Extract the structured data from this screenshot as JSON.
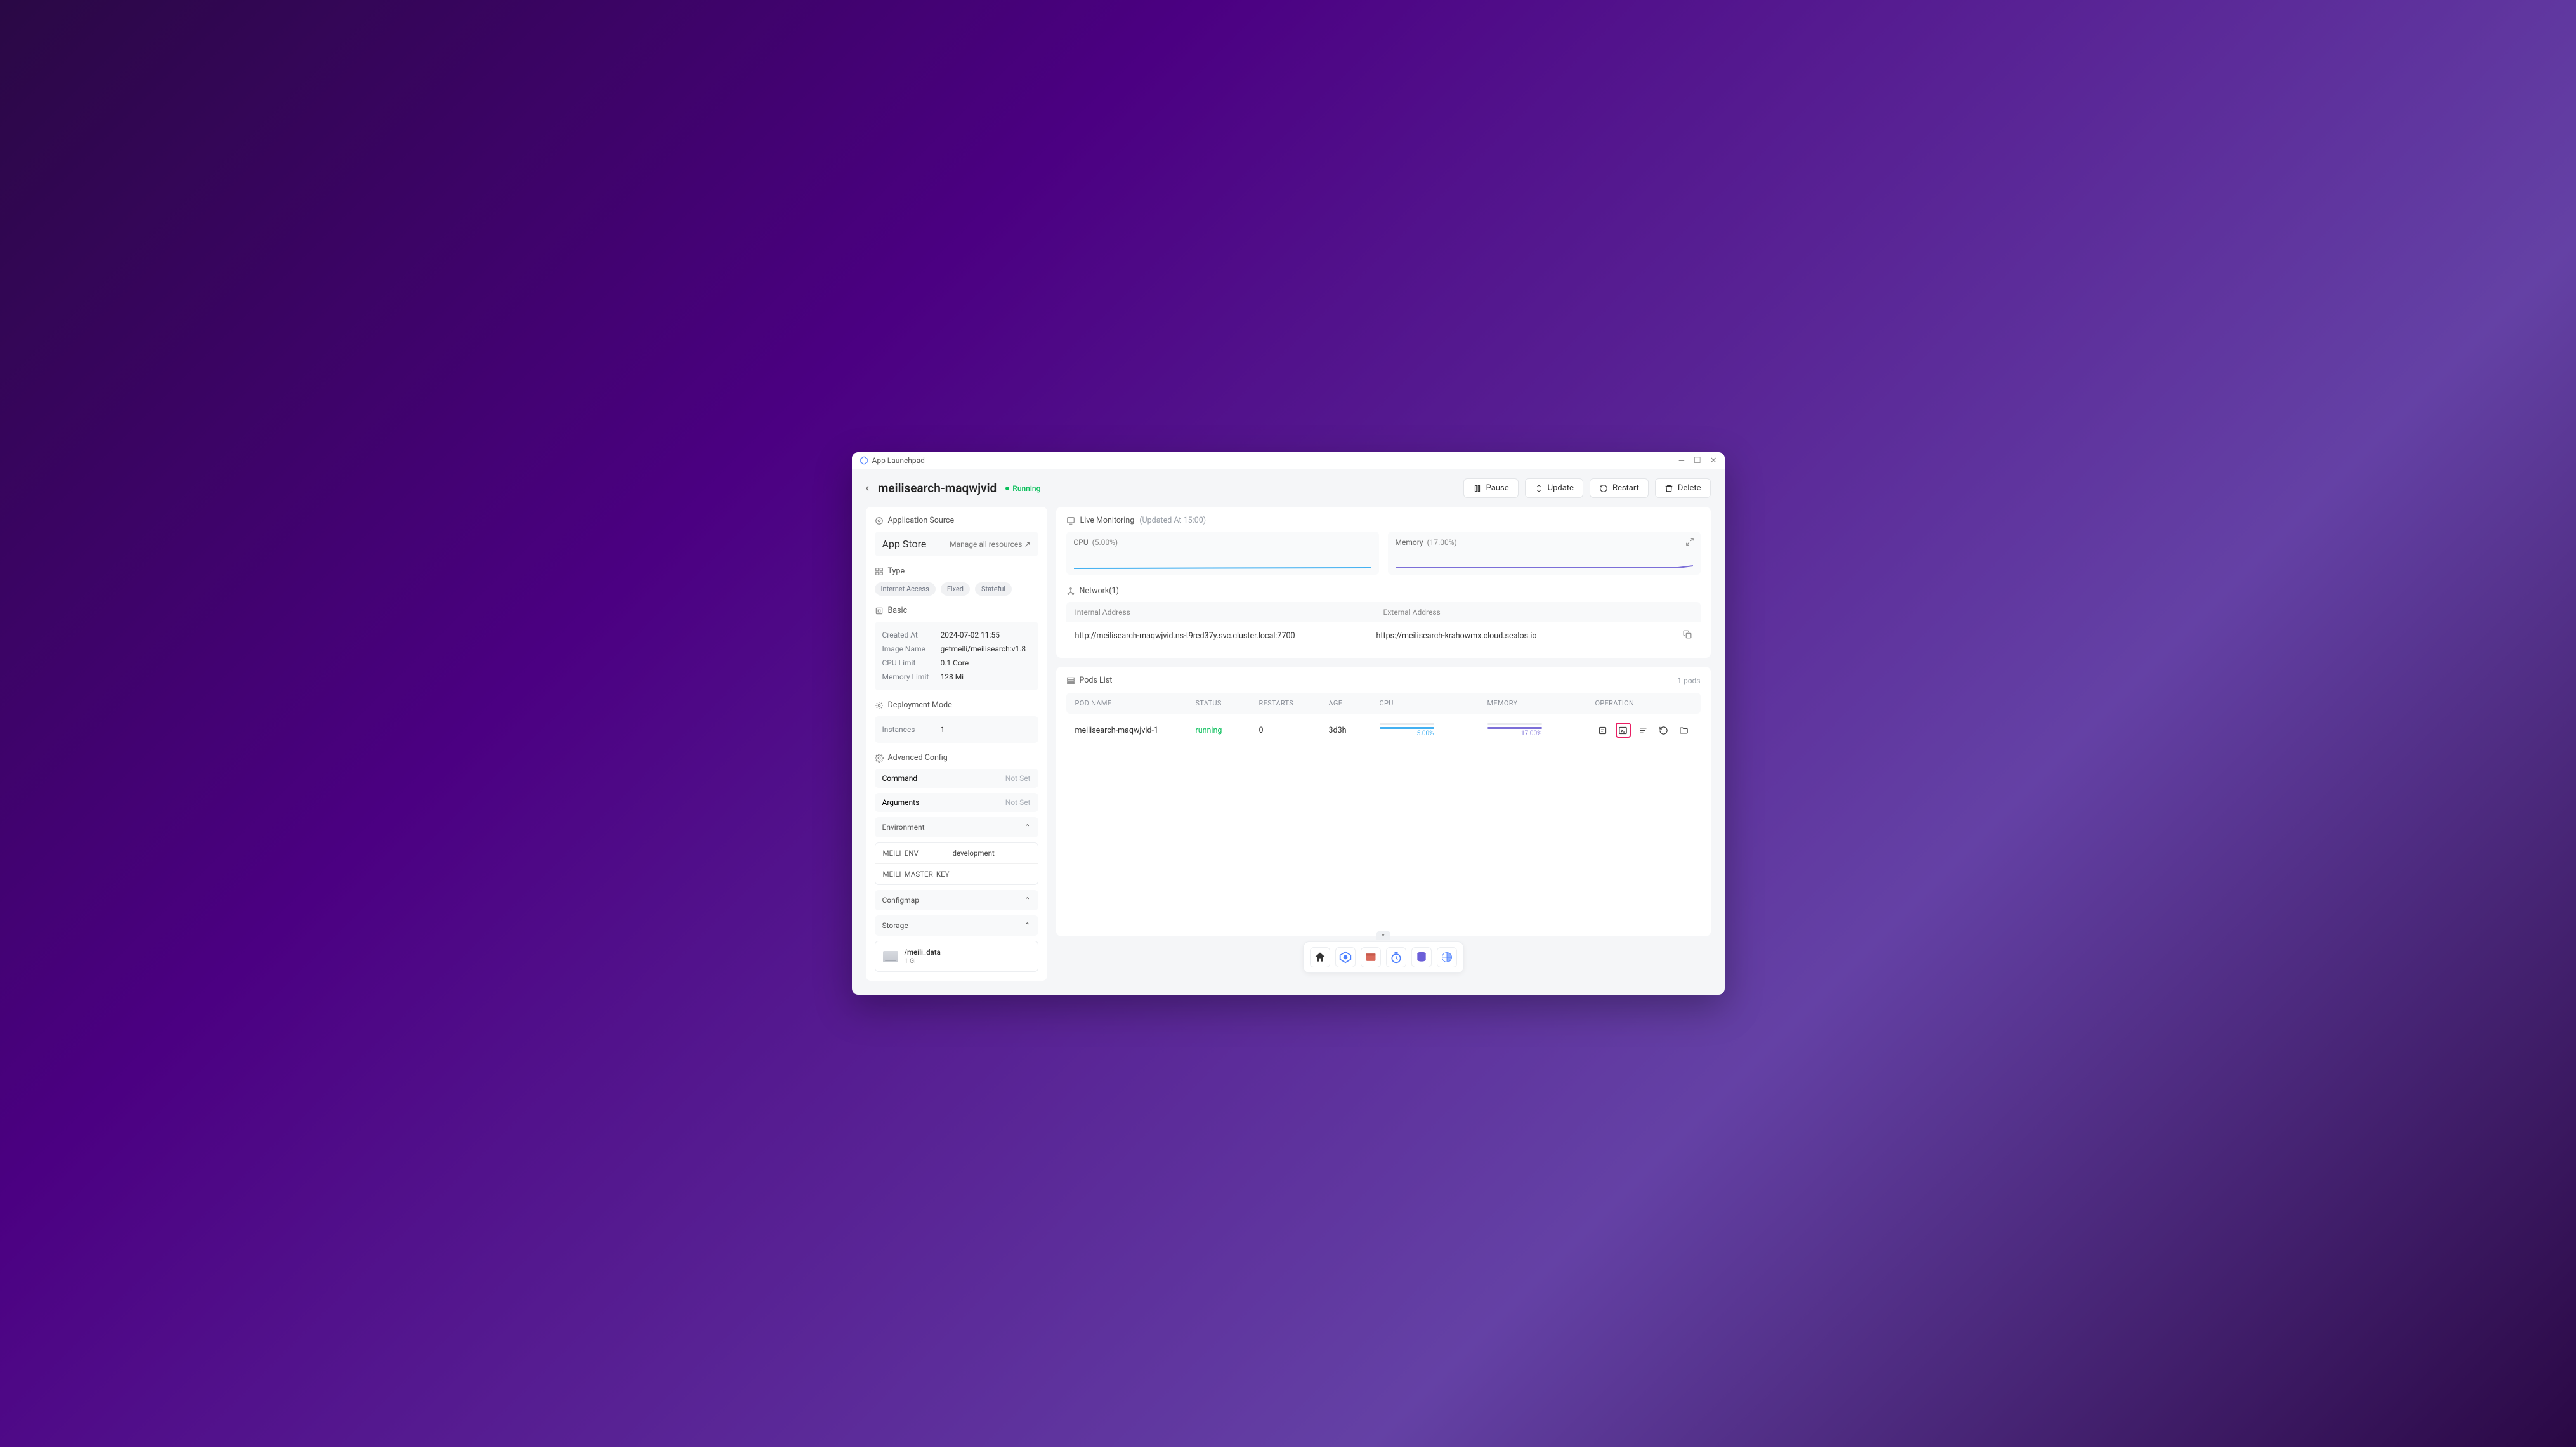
{
  "titlebar": {
    "app_name": "App Launchpad"
  },
  "header": {
    "title": "meilisearch-maqwjvid",
    "status": "Running",
    "actions": {
      "pause": "Pause",
      "update": "Update",
      "restart": "Restart",
      "delete": "Delete"
    }
  },
  "sidebar": {
    "source": {
      "heading": "Application Source",
      "app_store": "App Store",
      "manage": "Manage all resources ↗"
    },
    "type": {
      "heading": "Type",
      "tags": [
        "Internet Access",
        "Fixed",
        "Stateful"
      ]
    },
    "basic": {
      "heading": "Basic",
      "rows": {
        "created_at_label": "Created At",
        "created_at": "2024-07-02 11:55",
        "image_label": "Image Name",
        "image": "getmeili/meilisearch:v1.8",
        "cpu_label": "CPU Limit",
        "cpu": "0.1 Core",
        "mem_label": "Memory Limit",
        "mem": "128 Mi"
      }
    },
    "deploy": {
      "heading": "Deployment Mode",
      "instances_label": "Instances",
      "instances": "1"
    },
    "advanced": {
      "heading": "Advanced Config",
      "command_label": "Command",
      "command": "Not Set",
      "arguments_label": "Arguments",
      "arguments": "Not Set",
      "environment_label": "Environment",
      "env": [
        {
          "key": "MEILI_ENV",
          "value": "development"
        },
        {
          "key": "MEILI_MASTER_KEY",
          "value": ""
        }
      ],
      "configmap_label": "Configmap",
      "storage_label": "Storage",
      "storage": {
        "path": "/meili_data",
        "size": "1 Gi"
      }
    }
  },
  "monitoring": {
    "heading": "Live Monitoring",
    "updated": "(Updated At  15:00)",
    "cpu_label": "CPU",
    "cpu_pct": "(5.00%)",
    "mem_label": "Memory",
    "mem_pct": "(17.00%)"
  },
  "network": {
    "heading": "Network(1)",
    "internal_label": "Internal Address",
    "external_label": "External Address",
    "internal": "http://meilisearch-maqwjvid.ns-t9red37y.svc.cluster.local:7700",
    "external": "https://meilisearch-krahowmx.cloud.sealos.io"
  },
  "pods": {
    "heading": "Pods List",
    "count": "1 pods",
    "columns": {
      "name": "POD NAME",
      "status": "STATUS",
      "restarts": "RESTARTS",
      "age": "AGE",
      "cpu": "CPU",
      "memory": "MEMORY",
      "operation": "OPERATION"
    },
    "rows": [
      {
        "name": "meilisearch-maqwjvid-1",
        "status": "running",
        "restarts": "0",
        "age": "3d3h",
        "cpu": "5.00%",
        "memory": "17.00%"
      }
    ]
  }
}
